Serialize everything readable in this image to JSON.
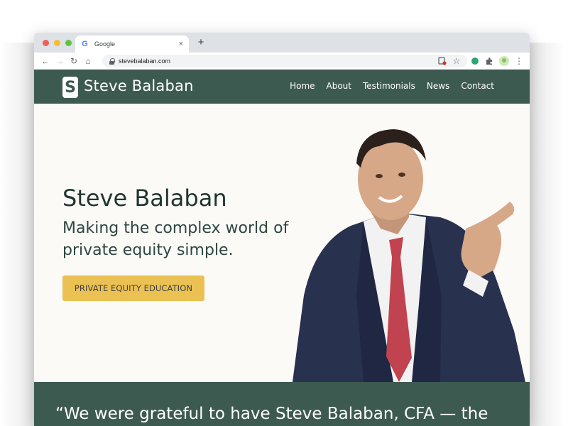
{
  "browser": {
    "tab": {
      "title": "Google",
      "favicon": "google-g-icon",
      "close": "×"
    },
    "new_tab": "+",
    "nav": {
      "back": "←",
      "forward": "→",
      "reload": "↻",
      "home": "⌂"
    },
    "url": "stevebalaban.com",
    "traffic_lights": [
      "#ee5e56",
      "#f6bd2e",
      "#5cc443"
    ]
  },
  "site": {
    "logo_letter": "S",
    "brand": "Steve Balaban",
    "nav": [
      {
        "label": "Home"
      },
      {
        "label": "About"
      },
      {
        "label": "Testimonials"
      },
      {
        "label": "News"
      },
      {
        "label": "Contact"
      }
    ],
    "hero": {
      "title": "Steve Balaban",
      "subtitle": "Making the complex world of private equity simple.",
      "cta": "PRIVATE EQUITY EDUCATION"
    },
    "quote": "“We were grateful to have Steve Balaban, CFA — the"
  },
  "colors": {
    "brand_green": "#3d5a51",
    "cta_yellow": "#ecc153",
    "hero_bg": "#fbfaf7"
  }
}
